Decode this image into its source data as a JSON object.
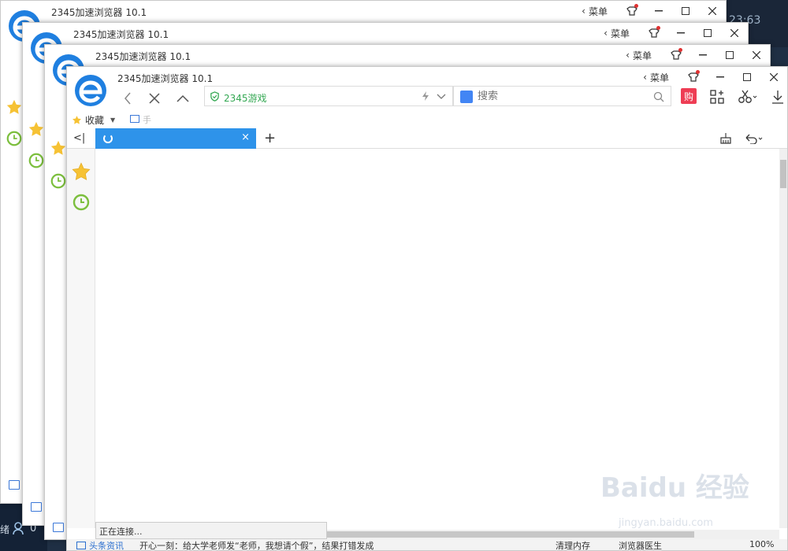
{
  "desktop": {
    "clock": "23:63",
    "tray_label": "绪",
    "user_count": "0"
  },
  "window": {
    "title": "2345加速浏览器 10.1",
    "menu_label": "菜单"
  },
  "nav": {
    "address_site": "2345游戏",
    "search_placeholder": "搜索",
    "shop_label": "购"
  },
  "favbar": {
    "favorites_label": "收藏",
    "secondary_label": "手"
  },
  "tab": {
    "new_tab_symbol": "+"
  },
  "status_popup": "正在连接...",
  "statusbar": {
    "news_label": "头条资讯",
    "headline": "开心一刻：给大学老师发“老师，我想请个假”，结果打错发成",
    "clean_memory": "清理内存",
    "doctor": "浏览器医生",
    "zoom": "100%"
  },
  "watermark": {
    "brand": "Baidu 经验",
    "url": "jingyan.baidu.com"
  },
  "colors": {
    "tab_blue": "#2e93ea",
    "logo_blue": "#1f7fe0",
    "star_yellow": "#f6c234",
    "clock_green": "#7cbf3d",
    "shop_red": "#ee3d54"
  }
}
